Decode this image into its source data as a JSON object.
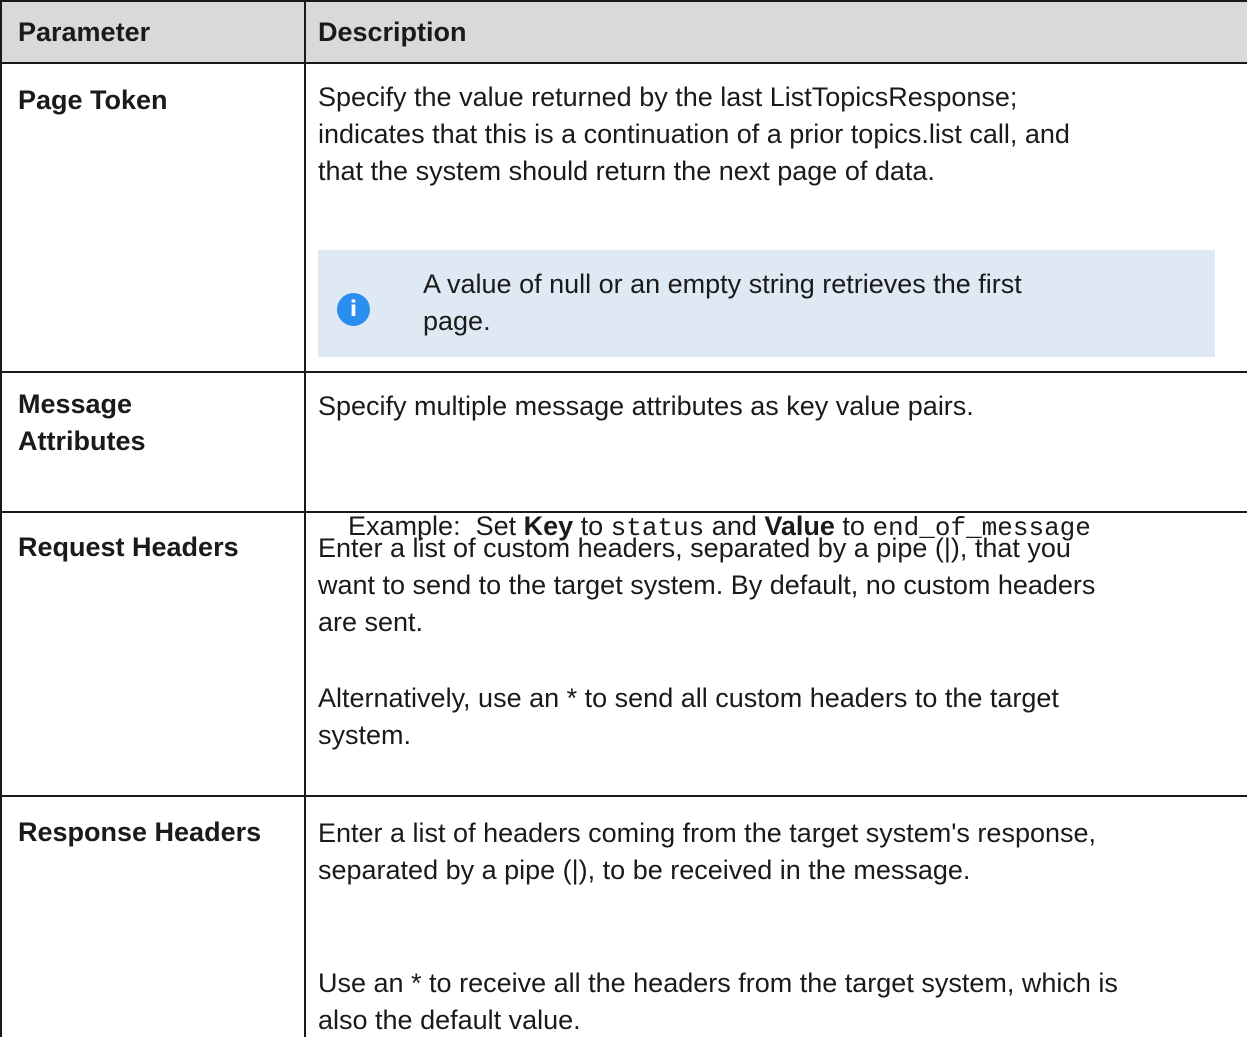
{
  "header": {
    "param": "Parameter",
    "desc": "Description"
  },
  "rows": [
    {
      "param": "Page Token",
      "lines": [
        "Specify the value returned by the last ListTopicsResponse;",
        "indicates that this is a continuation of a prior topics.list call, and",
        "that the system should return the next page of data."
      ],
      "note": {
        "icon": "info-icon",
        "lines": [
          "A value of null or an empty string retrieves the first",
          "page."
        ]
      }
    },
    {
      "param_lines": [
        "Message",
        "Attributes"
      ],
      "line1": "Specify multiple message attributes as key value pairs.",
      "example": {
        "prefix": "Example:  Set ",
        "key_label": "Key",
        "to1": " to ",
        "key_value": "status",
        "and": " and ",
        "value_label": "Value",
        "to2": " to ",
        "value_value": "end_of_message"
      }
    },
    {
      "param": "Request Headers",
      "lines": [
        "Enter a list of custom headers, separated by a pipe (|), that you",
        "want to send to the target system. By default, no custom headers",
        "are sent."
      ],
      "lines2": [
        "Alternatively, use an * to send all custom headers to the target",
        "system."
      ]
    },
    {
      "param": "Response Headers",
      "lines": [
        "Enter a list of headers coming from the target system's response,",
        "separated by a pipe (|), to be received in the message."
      ],
      "lines2": [
        "Use an * to receive all the headers from the target system, which is",
        "also the default value."
      ]
    }
  ]
}
